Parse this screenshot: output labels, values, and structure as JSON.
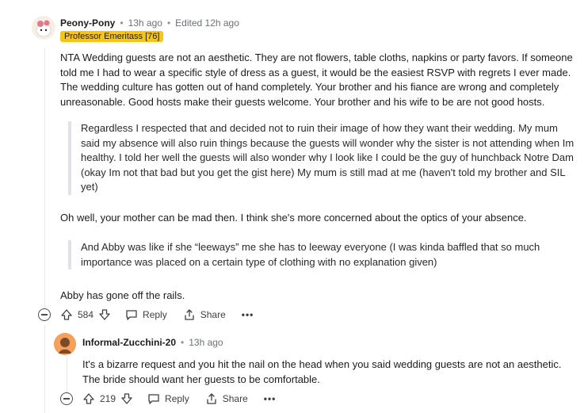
{
  "comment": {
    "username": "Peony-Pony",
    "time": "13h ago",
    "edited": "Edited 12h ago",
    "flair": "Professor Emeritass [76]",
    "paragraph1": "NTA Wedding guests are not an aesthetic. They are not flowers, table cloths, napkins or party favors. If someone told me I had to wear a specific style of dress as a guest, it would be the easiest RSVP with regrets I ever made. The wedding culture has gotten out of hand completely. Your brother and his fiance are wrong and completely unreasonable. Good hosts make their guests welcome. Your brother and his wife to be are not good hosts.",
    "quote1": "Regardless I respected that and decided not to ruin their image of how they want their wedding. My mum said my absence will also ruin things because the guests will wonder why the sister is not attending when Im healthy. I told her well the guests will also wonder why I look like I could be the guy of hunchback Notre Dam (okay Im not that bad but you get the gist here) My mum is still mad at me (haven't told my brother and SIL yet)",
    "paragraph2": "Oh well, your mother can be mad then. I think she's more concerned about the optics of your absence.",
    "quote2": "And Abby was like if she “leeways” me she has to leeway everyone (I was kinda baffled that so much importance was placed on a certain type of clothing with no explanation given)",
    "paragraph3": "Abby has gone off the rails.",
    "votes": "584",
    "reply_label": "Reply",
    "share_label": "Share",
    "more_label": "•••"
  },
  "reply": {
    "username": "Informal-Zucchini-20",
    "time": "13h ago",
    "text": "It's a bizarre request and you hit the nail on the head when you said wedding guests are not an aesthetic. The bride should want her guests to be comfortable.",
    "votes": "219",
    "reply_label": "Reply",
    "share_label": "Share",
    "more_label": "•••"
  },
  "separator": "•",
  "colors": {
    "flair_bg": "#f5c518",
    "avatar2_bg": "#f5a15c",
    "thread_line": "#e5e7ea"
  }
}
